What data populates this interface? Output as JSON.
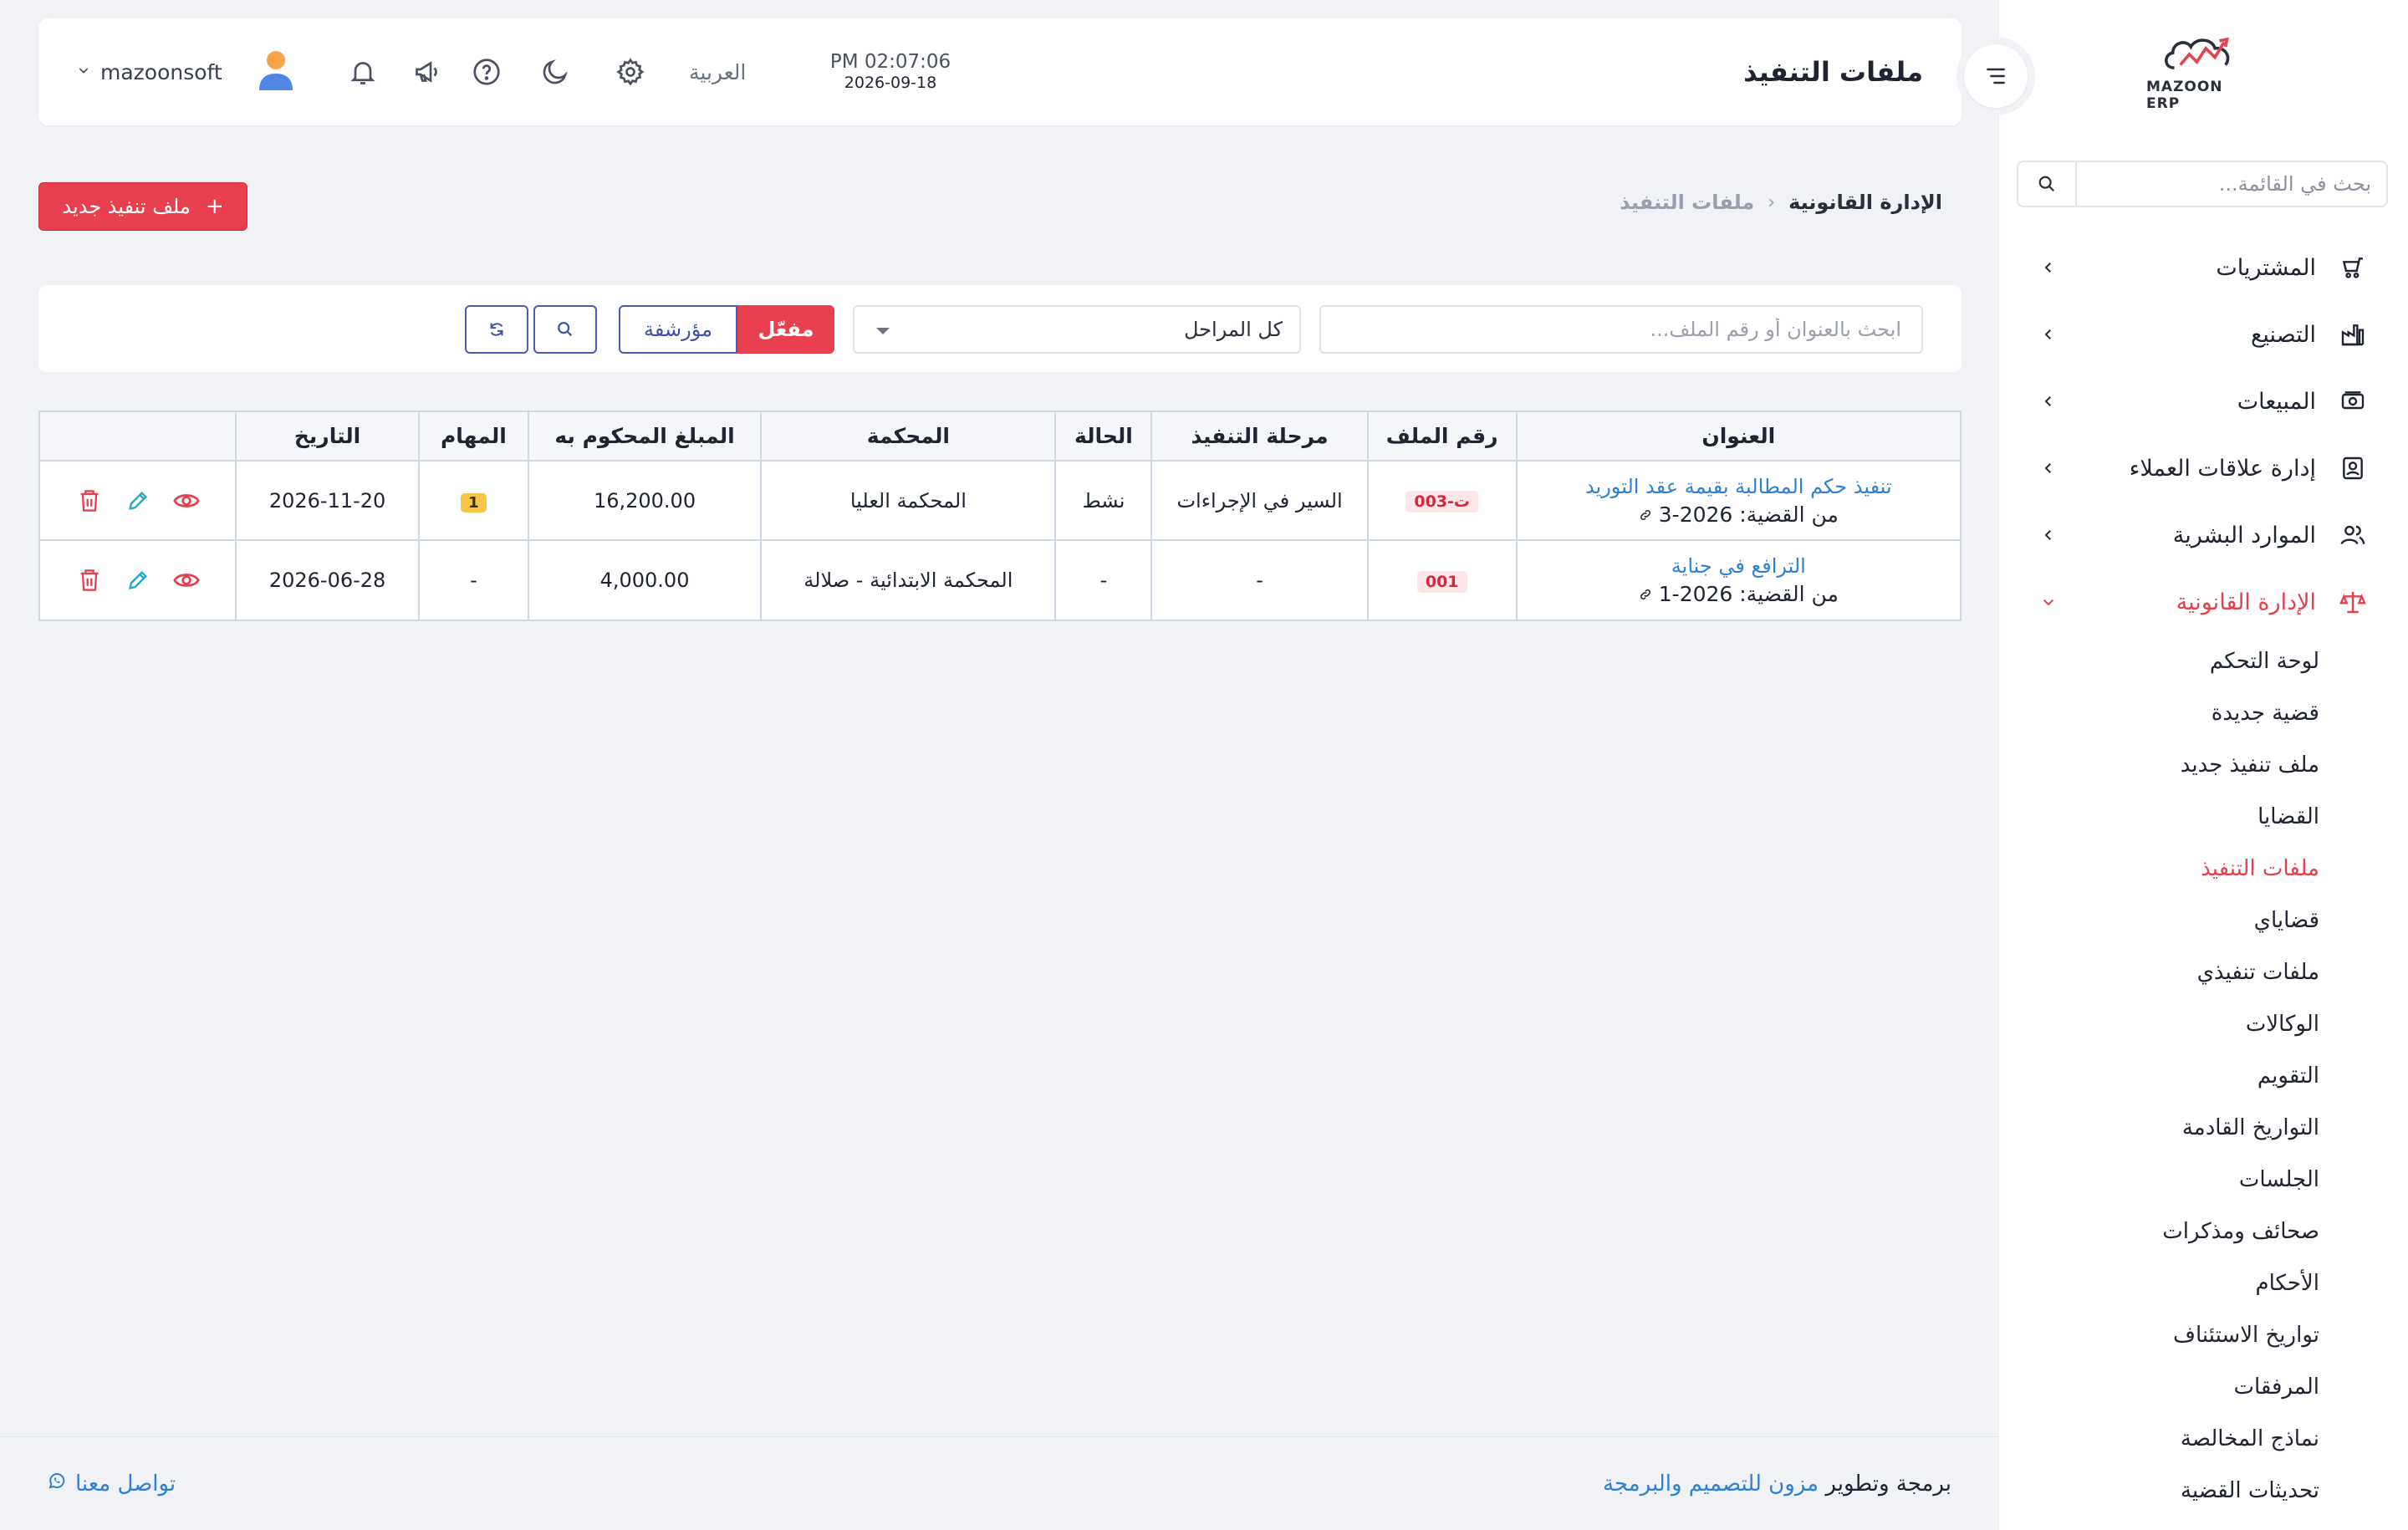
{
  "sidebar": {
    "logo_text": "MAZOON ERP",
    "search_placeholder": "بحث في القائمة...",
    "items": [
      {
        "label": "المشتريات",
        "icon": "cart-icon"
      },
      {
        "label": "التصنيع",
        "icon": "factory-icon"
      },
      {
        "label": "المبيعات",
        "icon": "cash-icon"
      },
      {
        "label": "إدارة علاقات العملاء",
        "icon": "contact-card-icon"
      },
      {
        "label": "الموارد البشرية",
        "icon": "users-icon"
      },
      {
        "label": "الإدارة القانونية",
        "icon": "scale-icon"
      }
    ],
    "legal_sub": [
      "لوحة التحكم",
      "قضية جديدة",
      "ملف تنفيذ جديد",
      "القضايا",
      "ملفات التنفيذ",
      "قضاياي",
      "ملفات تنفيذي",
      "الوكالات",
      "التقويم",
      "التواريخ القادمة",
      "الجلسات",
      "صحائف ومذكرات",
      "الأحكام",
      "تواريخ الاستئناف",
      "المرفقات",
      "نماذج المخالصة",
      "تحديثات القضية"
    ]
  },
  "header": {
    "title": "ملفات التنفيذ",
    "time": "PM 02:07:06",
    "date": "2026-09-18",
    "language": "العربية",
    "username": "mazoonsoft"
  },
  "breadcrumb": {
    "parent": "الإدارة القانونية",
    "current": "ملفات التنفيذ"
  },
  "new_button_label": "ملف تنفيذ جديد",
  "filters": {
    "search_placeholder": "ابحث بالعنوان أو رقم الملف...",
    "stage_selected": "كل المراحل",
    "active_label": "مفعّل",
    "archived_label": "مؤرشفة"
  },
  "table": {
    "headers": [
      "العنوان",
      "رقم الملف",
      "مرحلة التنفيذ",
      "الحالة",
      "المحكمة",
      "المبلغ المحكوم به",
      "المهام",
      "التاريخ",
      ""
    ],
    "rows": [
      {
        "title": "تنفيذ حكم المطالبة بقيمة عقد التوريد",
        "case_ref": "من القضية: 2026-3",
        "file_no": "ت-003",
        "stage": "السير في الإجراءات",
        "status": "نشط",
        "court": "المحكمة العليا",
        "amount": "16,200.00",
        "tasks": "1",
        "date": "2026-11-20"
      },
      {
        "title": "الترافع في جناية",
        "case_ref": "من القضية: 2026-1",
        "file_no": "001",
        "stage": "-",
        "status": "-",
        "court": "المحكمة الابتدائية - صلالة",
        "amount": "4,000.00",
        "tasks": "-",
        "date": "2026-06-28"
      }
    ]
  },
  "footer": {
    "credit_prefix": "برمجة وتطوير",
    "credit_brand": "مزون للتصميم والبرمجة",
    "contact": "تواصل معنا"
  },
  "colors": {
    "accent_red": "#e8404e",
    "link_blue": "#2f7fd3",
    "outline_blue": "#4a5bb0"
  }
}
